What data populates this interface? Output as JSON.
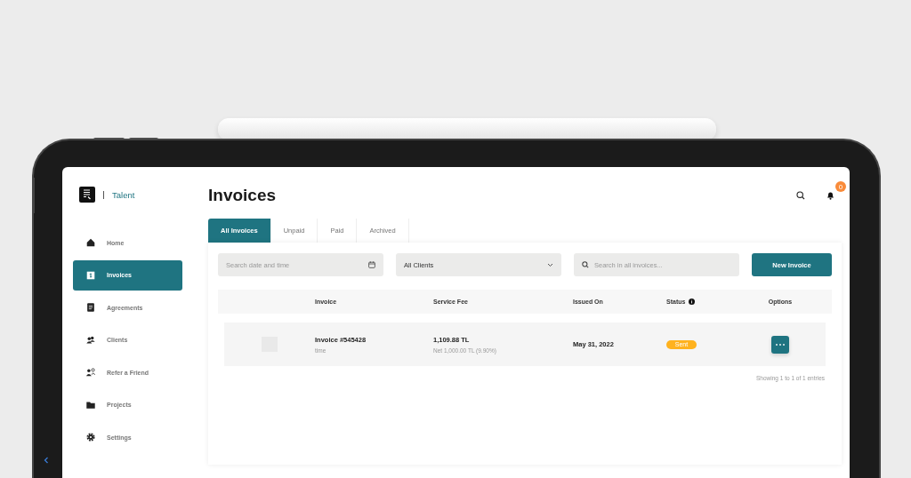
{
  "brand": {
    "name": "Talent"
  },
  "sidebar": {
    "items": [
      {
        "label": "Home",
        "kind": "home",
        "selected": false
      },
      {
        "label": "Invoices",
        "kind": "invoice",
        "selected": true
      },
      {
        "label": "Agreements",
        "kind": "document",
        "selected": false
      },
      {
        "label": "Clients",
        "kind": "people",
        "selected": false
      },
      {
        "label": "Refer a Friend",
        "kind": "refer",
        "selected": false
      },
      {
        "label": "Projects",
        "kind": "folder",
        "selected": false
      },
      {
        "label": "Settings",
        "kind": "gear",
        "selected": false
      }
    ]
  },
  "page_title": "Invoices",
  "notifications": {
    "count": "0"
  },
  "tabs": [
    {
      "label": "All Invoices",
      "selected": true
    },
    {
      "label": "Unpaid",
      "selected": false
    },
    {
      "label": "Paid",
      "selected": false
    },
    {
      "label": "Archived",
      "selected": false
    }
  ],
  "filters": {
    "date": {
      "placeholder": "Search date and time"
    },
    "client": {
      "value": "All Clients"
    },
    "search": {
      "placeholder": "Search in all invoices..."
    }
  },
  "new_button": "New Invoice",
  "table": {
    "columns": [
      {
        "label": "Invoice",
        "kind": "plain"
      },
      {
        "label": "Service Fee",
        "kind": "plain"
      },
      {
        "label": "Issued On",
        "kind": "plain"
      },
      {
        "label": "Status",
        "kind": "info"
      },
      {
        "label": "Options",
        "kind": "plain"
      }
    ],
    "rows": [
      {
        "invoice": "Invoice #545428",
        "note": "time",
        "fee": "1,109.88 TL",
        "fee_detail": "Net 1,000.00 TL (9.90%)",
        "issued": "May 31, 2022",
        "status": "Sent",
        "color": "#ffb21e"
      }
    ]
  },
  "footer": "Showing 1 to 1 of 1 entries"
}
